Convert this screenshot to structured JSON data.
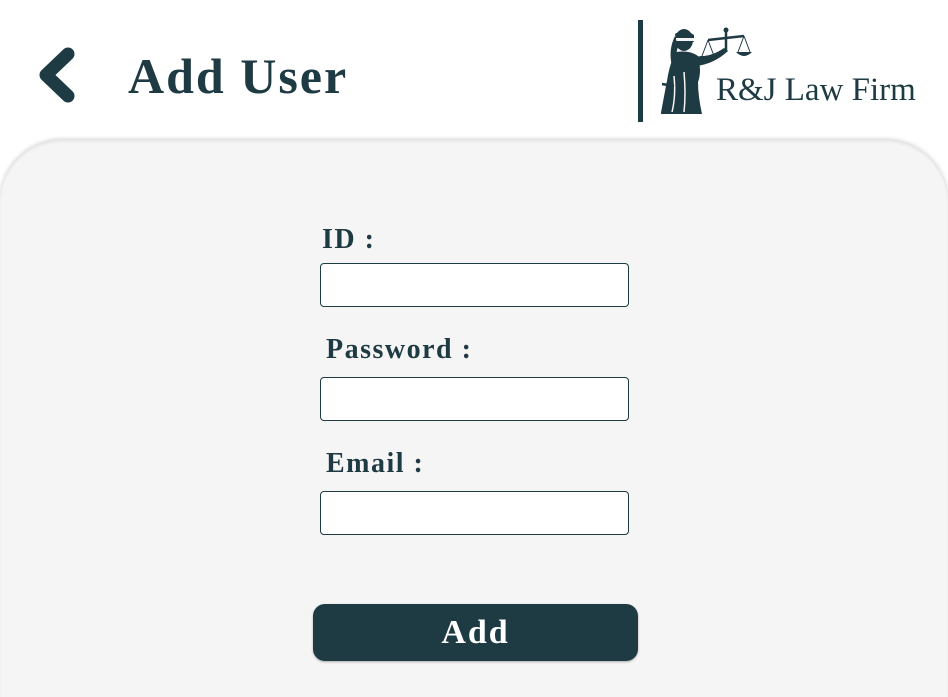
{
  "header": {
    "title": "Add User",
    "back_icon": "chevron-left-icon"
  },
  "brand": {
    "name": "R&J Law Firm",
    "logo_icon": "lady-justice-icon"
  },
  "form": {
    "fields": [
      {
        "label": "ID :",
        "value": "",
        "placeholder": ""
      },
      {
        "label": "Password :",
        "value": "",
        "placeholder": ""
      },
      {
        "label": "Email :",
        "value": "",
        "placeholder": ""
      }
    ],
    "submit_label": "Add"
  },
  "colors": {
    "primary": "#1e3a43",
    "panel_background": "#f5f5f5",
    "page_background": "#ffffff",
    "button_text": "#ffffff"
  }
}
